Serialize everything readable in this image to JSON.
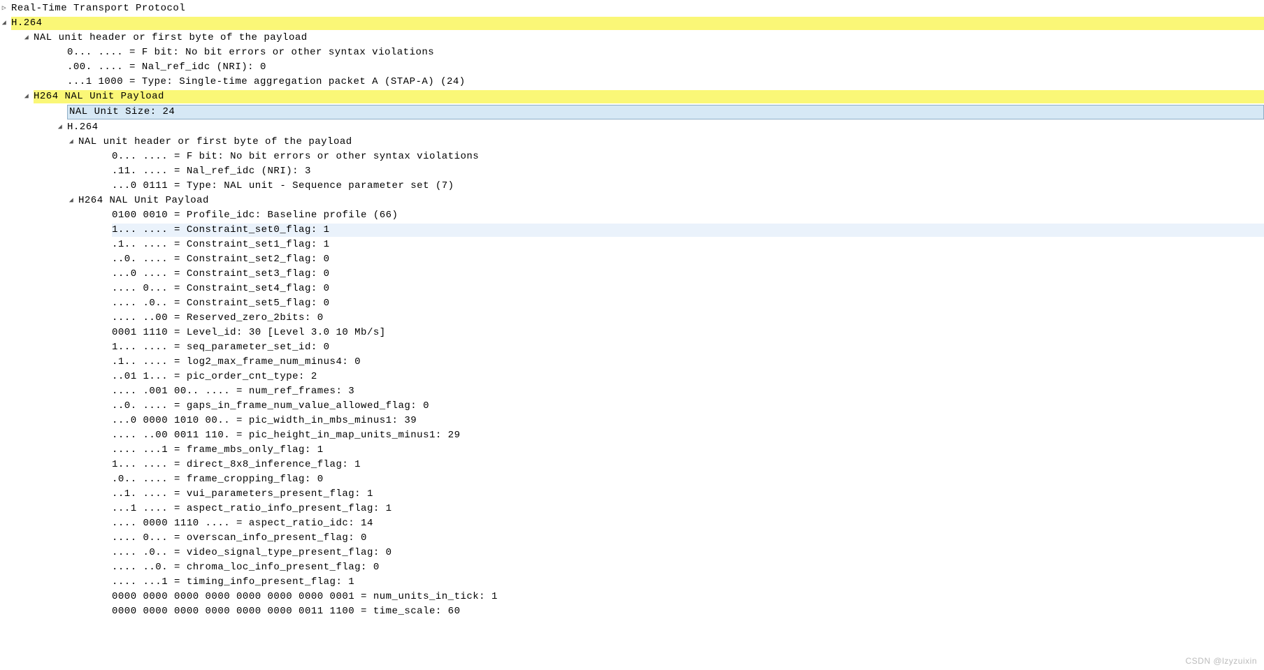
{
  "rtp": {
    "label": "Real-Time Transport Protocol"
  },
  "h264": {
    "label": "H.264",
    "header_label": "NAL unit header or first byte of the payload",
    "f_bit": "0... .... = F bit: No bit errors or other syntax violations",
    "nri": ".00. .... = Nal_ref_idc (NRI): 0",
    "type": "...1 1000 = Type: Single-time aggregation packet A (STAP-A) (24)",
    "payload_label": "H264 NAL Unit Payload",
    "nal_unit_size": "NAL Unit Size: 24",
    "inner": {
      "label": "H.264",
      "header_label": "NAL unit header or first byte of the payload",
      "f_bit": "0... .... = F bit: No bit errors or other syntax violations",
      "nri": ".11. .... = Nal_ref_idc (NRI): 3",
      "type": "...0 0111 = Type: NAL unit - Sequence parameter set (7)",
      "payload_label": "H264 NAL Unit Payload",
      "p": {
        "profile_idc": "0100 0010 = Profile_idc: Baseline profile (66)",
        "cs0": "1... .... = Constraint_set0_flag: 1",
        "cs1": ".1.. .... = Constraint_set1_flag: 1",
        "cs2": "..0. .... = Constraint_set2_flag: 0",
        "cs3": "...0 .... = Constraint_set3_flag: 0",
        "cs4": ".... 0... = Constraint_set4_flag: 0",
        "cs5": ".... .0.. = Constraint_set5_flag: 0",
        "reserved": ".... ..00 = Reserved_zero_2bits: 0",
        "level_id": "0001 1110 = Level_id: 30 [Level 3.0 10 Mb/s]",
        "sps_id": "1... .... = seq_parameter_set_id: 0",
        "log2_max_frame": ".1.. .... = log2_max_frame_num_minus4: 0",
        "pic_order": "..01 1... = pic_order_cnt_type: 2",
        "num_ref_frames": ".... .001  00.. .... = num_ref_frames: 3",
        "gaps": "..0. .... = gaps_in_frame_num_value_allowed_flag: 0",
        "pic_width": "...0 0000  1010 00.. = pic_width_in_mbs_minus1: 39",
        "pic_height": ".... ..00  0011 110. = pic_height_in_map_units_minus1: 29",
        "frame_mbs_only": ".... ...1 = frame_mbs_only_flag: 1",
        "direct8x8": "1... .... = direct_8x8_inference_flag: 1",
        "frame_crop": ".0.. .... = frame_cropping_flag: 0",
        "vui": "..1. .... = vui_parameters_present_flag: 1",
        "aspect_info": "...1 .... = aspect_ratio_info_present_flag: 1",
        "aspect_idc": ".... 0000  1110 .... = aspect_ratio_idc: 14",
        "overscan": ".... 0... = overscan_info_present_flag: 0",
        "video_signal": ".... .0.. = video_signal_type_present_flag: 0",
        "chroma_loc": ".... ..0. = chroma_loc_info_present_flag: 0",
        "timing_info": ".... ...1 = timing_info_present_flag: 1",
        "num_units_tick": "0000 0000  0000 0000  0000 0000  0000 0001 = num_units_in_tick: 1",
        "time_scale": "0000 0000  0000 0000  0000 0000  0011 1100 = time_scale: 60"
      }
    }
  },
  "watermark": "CSDN @lzyzuixin"
}
